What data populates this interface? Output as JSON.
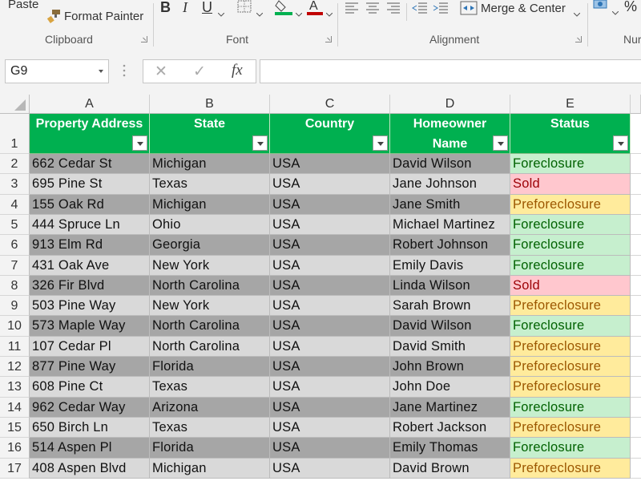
{
  "ribbon": {
    "paste_label": "Paste",
    "format_painter_label": "Format Painter",
    "clipboard_group": "Clipboard",
    "font_group": "Font",
    "bold": "B",
    "italic": "I",
    "underline": "U",
    "alignment_group": "Alignment",
    "merge_center_label": "Merge & Center",
    "number_group": "Nur",
    "percent": "%"
  },
  "formula_bar": {
    "name_box": "G9",
    "fx": "fx",
    "cancel": "✕",
    "enter": "✓",
    "value": ""
  },
  "columns": [
    "A",
    "B",
    "C",
    "D",
    "E"
  ],
  "headers": {
    "row_number": "1",
    "a": "Property Address",
    "b": "State",
    "c": "Country",
    "d1": "Homeowner",
    "d2": "Name",
    "e": "Status"
  },
  "rows": [
    {
      "n": "2",
      "address": "662 Cedar St",
      "state": "Michigan",
      "country": "USA",
      "owner": "David Wilson",
      "status": "Foreclosure",
      "status_type": "fore"
    },
    {
      "n": "3",
      "address": "695 Pine St",
      "state": "Texas",
      "country": "USA",
      "owner": "Jane Johnson",
      "status": "Sold",
      "status_type": "sold"
    },
    {
      "n": "4",
      "address": "155 Oak Rd",
      "state": "Michigan",
      "country": "USA",
      "owner": "Jane Smith",
      "status": "Preforeclosure",
      "status_type": "pre"
    },
    {
      "n": "5",
      "address": "444 Spruce Ln",
      "state": "Ohio",
      "country": "USA",
      "owner": "Michael Martinez",
      "status": "Foreclosure",
      "status_type": "fore"
    },
    {
      "n": "6",
      "address": "913 Elm Rd",
      "state": "Georgia",
      "country": "USA",
      "owner": "Robert Johnson",
      "status": "Foreclosure",
      "status_type": "fore"
    },
    {
      "n": "7",
      "address": "431 Oak Ave",
      "state": "New York",
      "country": "USA",
      "owner": "Emily Davis",
      "status": "Foreclosure",
      "status_type": "fore"
    },
    {
      "n": "8",
      "address": "326 Fir Blvd",
      "state": "North Carolina",
      "country": "USA",
      "owner": "Linda Wilson",
      "status": "Sold",
      "status_type": "sold"
    },
    {
      "n": "9",
      "address": "503 Pine Way",
      "state": "New York",
      "country": "USA",
      "owner": "Sarah Brown",
      "status": "Preforeclosure",
      "status_type": "pre"
    },
    {
      "n": "10",
      "address": "573 Maple Way",
      "state": "North Carolina",
      "country": "USA",
      "owner": "David Wilson",
      "status": "Foreclosure",
      "status_type": "fore"
    },
    {
      "n": "11",
      "address": "107 Cedar Pl",
      "state": "North Carolina",
      "country": "USA",
      "owner": "David Smith",
      "status": "Preforeclosure",
      "status_type": "pre"
    },
    {
      "n": "12",
      "address": "877 Pine Way",
      "state": "Florida",
      "country": "USA",
      "owner": "John Brown",
      "status": "Preforeclosure",
      "status_type": "pre"
    },
    {
      "n": "13",
      "address": "608 Pine Ct",
      "state": "Texas",
      "country": "USA",
      "owner": "John Doe",
      "status": "Preforeclosure",
      "status_type": "pre"
    },
    {
      "n": "14",
      "address": "962 Cedar Way",
      "state": "Arizona",
      "country": "USA",
      "owner": "Jane Martinez",
      "status": "Foreclosure",
      "status_type": "fore"
    },
    {
      "n": "15",
      "address": "650 Birch Ln",
      "state": "Texas",
      "country": "USA",
      "owner": "Robert Jackson",
      "status": "Preforeclosure",
      "status_type": "pre"
    },
    {
      "n": "16",
      "address": "514 Aspen Pl",
      "state": "Florida",
      "country": "USA",
      "owner": "Emily Thomas",
      "status": "Foreclosure",
      "status_type": "fore"
    },
    {
      "n": "17",
      "address": "408 Aspen Blvd",
      "state": "Michigan",
      "country": "USA",
      "owner": "David Brown",
      "status": "Preforeclosure",
      "status_type": "pre"
    }
  ],
  "colors": {
    "header_green": "#00b050",
    "row_dark": "#a6a6a6",
    "row_light": "#d9d9d9",
    "foreclosure_fill": "#c6efce",
    "sold_fill": "#ffc7ce",
    "preforeclosure_fill": "#ffeb9c"
  }
}
